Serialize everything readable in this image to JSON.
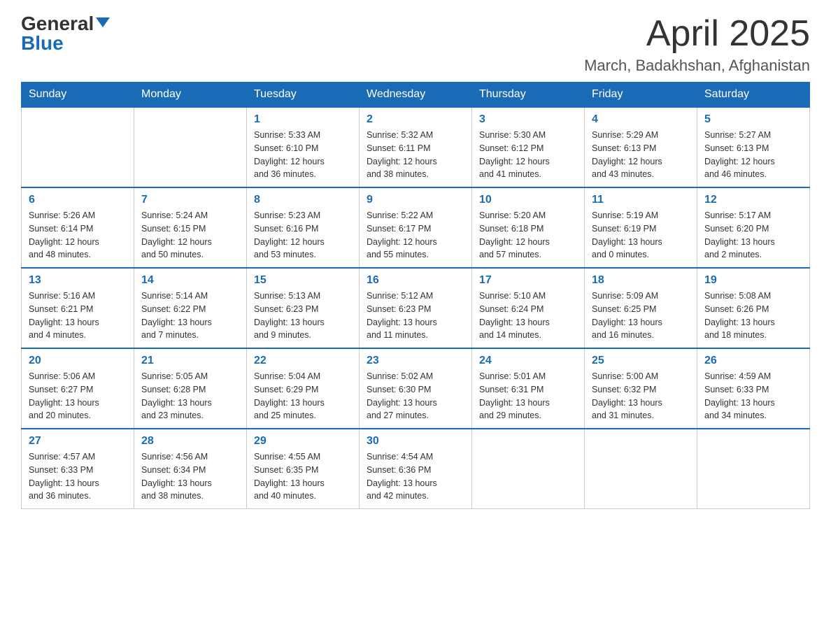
{
  "header": {
    "logo_general": "General",
    "logo_blue": "Blue",
    "month_title": "April 2025",
    "location": "March, Badakhshan, Afghanistan"
  },
  "days_of_week": [
    "Sunday",
    "Monday",
    "Tuesday",
    "Wednesday",
    "Thursday",
    "Friday",
    "Saturday"
  ],
  "weeks": [
    [
      {
        "day": "",
        "info": ""
      },
      {
        "day": "",
        "info": ""
      },
      {
        "day": "1",
        "info": "Sunrise: 5:33 AM\nSunset: 6:10 PM\nDaylight: 12 hours\nand 36 minutes."
      },
      {
        "day": "2",
        "info": "Sunrise: 5:32 AM\nSunset: 6:11 PM\nDaylight: 12 hours\nand 38 minutes."
      },
      {
        "day": "3",
        "info": "Sunrise: 5:30 AM\nSunset: 6:12 PM\nDaylight: 12 hours\nand 41 minutes."
      },
      {
        "day": "4",
        "info": "Sunrise: 5:29 AM\nSunset: 6:13 PM\nDaylight: 12 hours\nand 43 minutes."
      },
      {
        "day": "5",
        "info": "Sunrise: 5:27 AM\nSunset: 6:13 PM\nDaylight: 12 hours\nand 46 minutes."
      }
    ],
    [
      {
        "day": "6",
        "info": "Sunrise: 5:26 AM\nSunset: 6:14 PM\nDaylight: 12 hours\nand 48 minutes."
      },
      {
        "day": "7",
        "info": "Sunrise: 5:24 AM\nSunset: 6:15 PM\nDaylight: 12 hours\nand 50 minutes."
      },
      {
        "day": "8",
        "info": "Sunrise: 5:23 AM\nSunset: 6:16 PM\nDaylight: 12 hours\nand 53 minutes."
      },
      {
        "day": "9",
        "info": "Sunrise: 5:22 AM\nSunset: 6:17 PM\nDaylight: 12 hours\nand 55 minutes."
      },
      {
        "day": "10",
        "info": "Sunrise: 5:20 AM\nSunset: 6:18 PM\nDaylight: 12 hours\nand 57 minutes."
      },
      {
        "day": "11",
        "info": "Sunrise: 5:19 AM\nSunset: 6:19 PM\nDaylight: 13 hours\nand 0 minutes."
      },
      {
        "day": "12",
        "info": "Sunrise: 5:17 AM\nSunset: 6:20 PM\nDaylight: 13 hours\nand 2 minutes."
      }
    ],
    [
      {
        "day": "13",
        "info": "Sunrise: 5:16 AM\nSunset: 6:21 PM\nDaylight: 13 hours\nand 4 minutes."
      },
      {
        "day": "14",
        "info": "Sunrise: 5:14 AM\nSunset: 6:22 PM\nDaylight: 13 hours\nand 7 minutes."
      },
      {
        "day": "15",
        "info": "Sunrise: 5:13 AM\nSunset: 6:23 PM\nDaylight: 13 hours\nand 9 minutes."
      },
      {
        "day": "16",
        "info": "Sunrise: 5:12 AM\nSunset: 6:23 PM\nDaylight: 13 hours\nand 11 minutes."
      },
      {
        "day": "17",
        "info": "Sunrise: 5:10 AM\nSunset: 6:24 PM\nDaylight: 13 hours\nand 14 minutes."
      },
      {
        "day": "18",
        "info": "Sunrise: 5:09 AM\nSunset: 6:25 PM\nDaylight: 13 hours\nand 16 minutes."
      },
      {
        "day": "19",
        "info": "Sunrise: 5:08 AM\nSunset: 6:26 PM\nDaylight: 13 hours\nand 18 minutes."
      }
    ],
    [
      {
        "day": "20",
        "info": "Sunrise: 5:06 AM\nSunset: 6:27 PM\nDaylight: 13 hours\nand 20 minutes."
      },
      {
        "day": "21",
        "info": "Sunrise: 5:05 AM\nSunset: 6:28 PM\nDaylight: 13 hours\nand 23 minutes."
      },
      {
        "day": "22",
        "info": "Sunrise: 5:04 AM\nSunset: 6:29 PM\nDaylight: 13 hours\nand 25 minutes."
      },
      {
        "day": "23",
        "info": "Sunrise: 5:02 AM\nSunset: 6:30 PM\nDaylight: 13 hours\nand 27 minutes."
      },
      {
        "day": "24",
        "info": "Sunrise: 5:01 AM\nSunset: 6:31 PM\nDaylight: 13 hours\nand 29 minutes."
      },
      {
        "day": "25",
        "info": "Sunrise: 5:00 AM\nSunset: 6:32 PM\nDaylight: 13 hours\nand 31 minutes."
      },
      {
        "day": "26",
        "info": "Sunrise: 4:59 AM\nSunset: 6:33 PM\nDaylight: 13 hours\nand 34 minutes."
      }
    ],
    [
      {
        "day": "27",
        "info": "Sunrise: 4:57 AM\nSunset: 6:33 PM\nDaylight: 13 hours\nand 36 minutes."
      },
      {
        "day": "28",
        "info": "Sunrise: 4:56 AM\nSunset: 6:34 PM\nDaylight: 13 hours\nand 38 minutes."
      },
      {
        "day": "29",
        "info": "Sunrise: 4:55 AM\nSunset: 6:35 PM\nDaylight: 13 hours\nand 40 minutes."
      },
      {
        "day": "30",
        "info": "Sunrise: 4:54 AM\nSunset: 6:36 PM\nDaylight: 13 hours\nand 42 minutes."
      },
      {
        "day": "",
        "info": ""
      },
      {
        "day": "",
        "info": ""
      },
      {
        "day": "",
        "info": ""
      }
    ]
  ]
}
